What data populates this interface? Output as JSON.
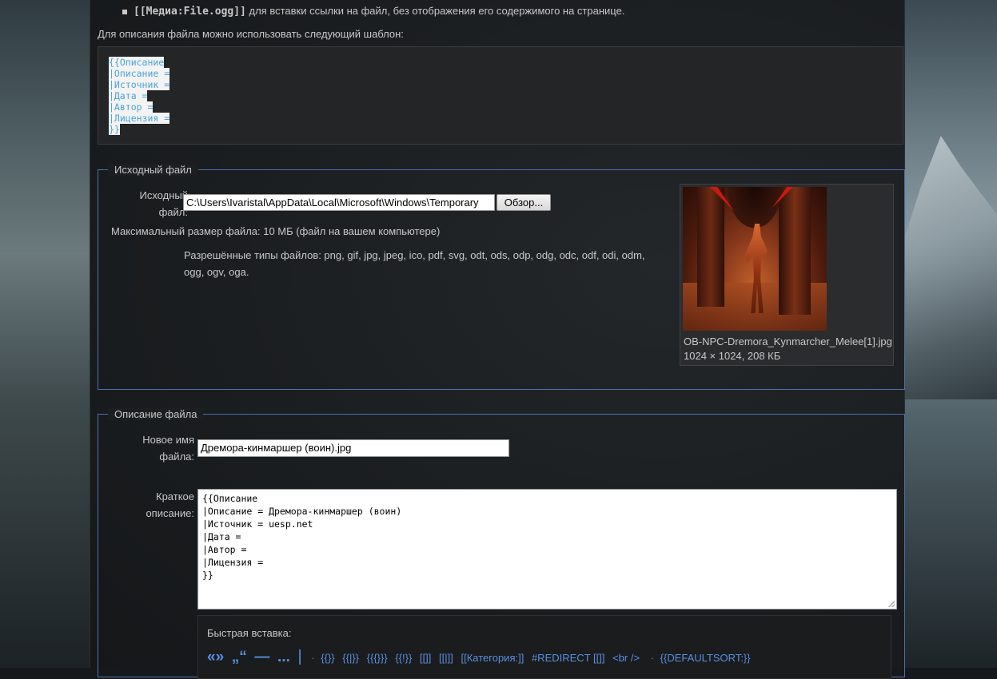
{
  "top": {
    "bullet_code": "[[Медиа:File.ogg]]",
    "bullet_text": " для вставки ссылки на файл, без отображения его содержимого на странице.",
    "template_note": "Для описания файла можно использовать следующий шаблон:",
    "template_lines": [
      "{{Описание",
      "|Описание =",
      "|Источник =",
      "|Дата =",
      "|Автор =",
      "|Лицензия =",
      "}}"
    ]
  },
  "source_section": {
    "legend": "Исходный файл",
    "file_label_line1": "Исходный",
    "file_label_line2": "файл:",
    "file_input_value": "C:\\Users\\Ivaristal\\AppData\\Local\\Microsoft\\Windows\\Temporary",
    "browse_label": "Обзор...",
    "max_size": "Максимальный размер файла: 10 МБ (файл на вашем компьютере)",
    "allowed_line1": "Разрешённые типы файлов: png, gif, jpg, jpeg, ico, pdf, svg, odt, ods, odp, odg, odc, odf, odi, odm,",
    "allowed_line2": "ogg, ogv, oga.",
    "preview_filename": "OB-NPC-Dremora_Kynmarcher_Melee[1].jpg",
    "preview_info": "1024 × 1024, 208 КБ"
  },
  "description_section": {
    "legend": "Описание файла",
    "new_name_label_line1": "Новое имя",
    "new_name_label_line2": "файла:",
    "new_name_value": "Дремора-кинмаршер (воин).jpg",
    "summary_label_line1": "Краткое",
    "summary_label_line2": "описание:",
    "summary_text": "{{Описание\n|Описание = Дремора-кинмаршер (воин)\n|Источник = uesp.net\n|Дата =\n|Автор =\n|Лицензия =\n}}",
    "quick_insert_title": "Быстрая вставка:",
    "quick_big": [
      "«»",
      "„“",
      "—",
      "..."
    ],
    "quick_items": [
      "{{}}",
      "{{|}}",
      "{{{}}}",
      "{{!}}",
      "[[]]",
      "[[|]]",
      "[[Категория:]]",
      "#REDIRECT [[]]",
      "<br />",
      "{{DEFAULTSORT:}}"
    ]
  }
}
